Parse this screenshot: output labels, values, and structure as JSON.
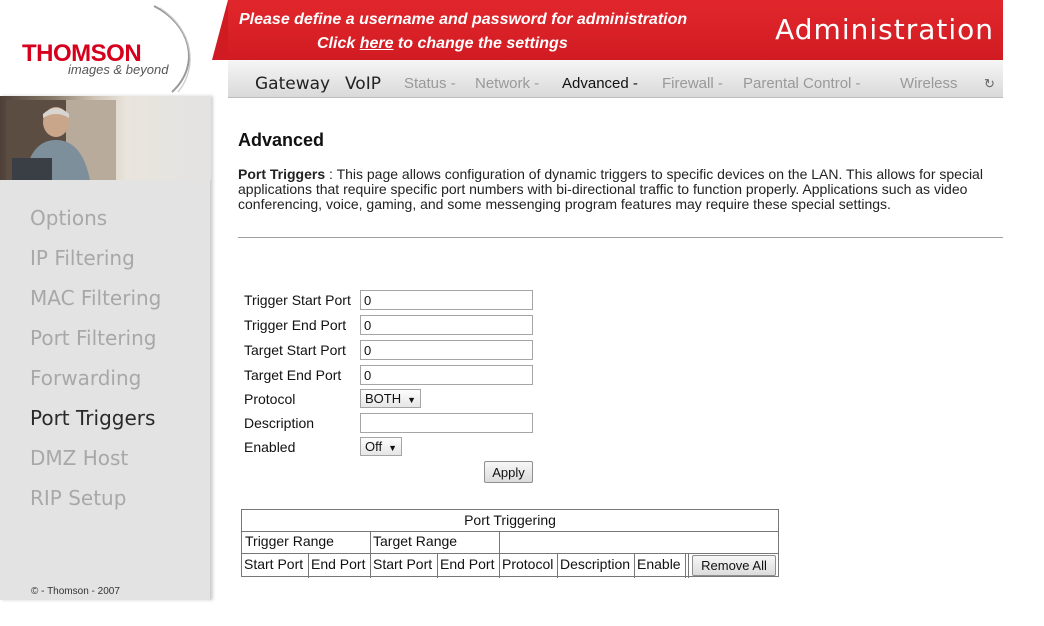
{
  "brand": {
    "name": "THOMSON",
    "tagline": "images & beyond"
  },
  "banner": {
    "line1": "Please define a username and password for administration",
    "line2_prefix": "Click ",
    "line2_link": "here",
    "line2_suffix": " to change the settings",
    "title": "Administration"
  },
  "nav": {
    "items": [
      {
        "label": "Gateway"
      },
      {
        "label": "VoIP"
      },
      {
        "label": "Status -"
      },
      {
        "label": "Network -"
      },
      {
        "label": "Advanced -"
      },
      {
        "label": "Firewall -"
      },
      {
        "label": "Parental Control -"
      },
      {
        "label": "Wireless"
      }
    ],
    "spinner_icon": "loading-spinner-icon"
  },
  "sidebar": {
    "items": [
      {
        "label": "Options"
      },
      {
        "label": "IP Filtering"
      },
      {
        "label": "MAC Filtering"
      },
      {
        "label": "Port Filtering"
      },
      {
        "label": "Forwarding"
      },
      {
        "label": "Port Triggers"
      },
      {
        "label": "DMZ Host"
      },
      {
        "label": "RIP Setup"
      }
    ],
    "active": "Port Triggers",
    "copyright": "© - Thomson - 2007"
  },
  "page": {
    "title": "Advanced",
    "intro_heading": "Port Triggers",
    "intro_sep": " :  ",
    "intro_text": "This page allows configuration of dynamic triggers to specific devices on the LAN. This allows for special applications that require specific port numbers with bi-directional traffic to function properly. Applications such as video conferencing, voice, gaming, and some messenging program features may require these special settings."
  },
  "form": {
    "trigger_start_label": "Trigger Start Port",
    "trigger_start_value": "0",
    "trigger_end_label": "Trigger End Port",
    "trigger_end_value": "0",
    "target_start_label": "Target Start Port",
    "target_start_value": "0",
    "target_end_label": "Target End Port",
    "target_end_value": "0",
    "protocol_label": "Protocol",
    "protocol_value": "BOTH",
    "description_label": "Description",
    "description_value": "",
    "enabled_label": "Enabled",
    "enabled_value": "Off",
    "apply_label": "Apply"
  },
  "table": {
    "caption": "Port Triggering",
    "group_trigger": "Trigger Range",
    "group_target": "Target Range",
    "columns": [
      "Start Port",
      "End Port",
      "Start Port",
      "End Port",
      "Protocol",
      "Description",
      "Enable"
    ],
    "remove_all_label": "Remove All"
  },
  "colors": {
    "banner_red": "#d11b22",
    "brand_red": "#d6001c",
    "sidebar_bg": "#e3e3e3"
  }
}
